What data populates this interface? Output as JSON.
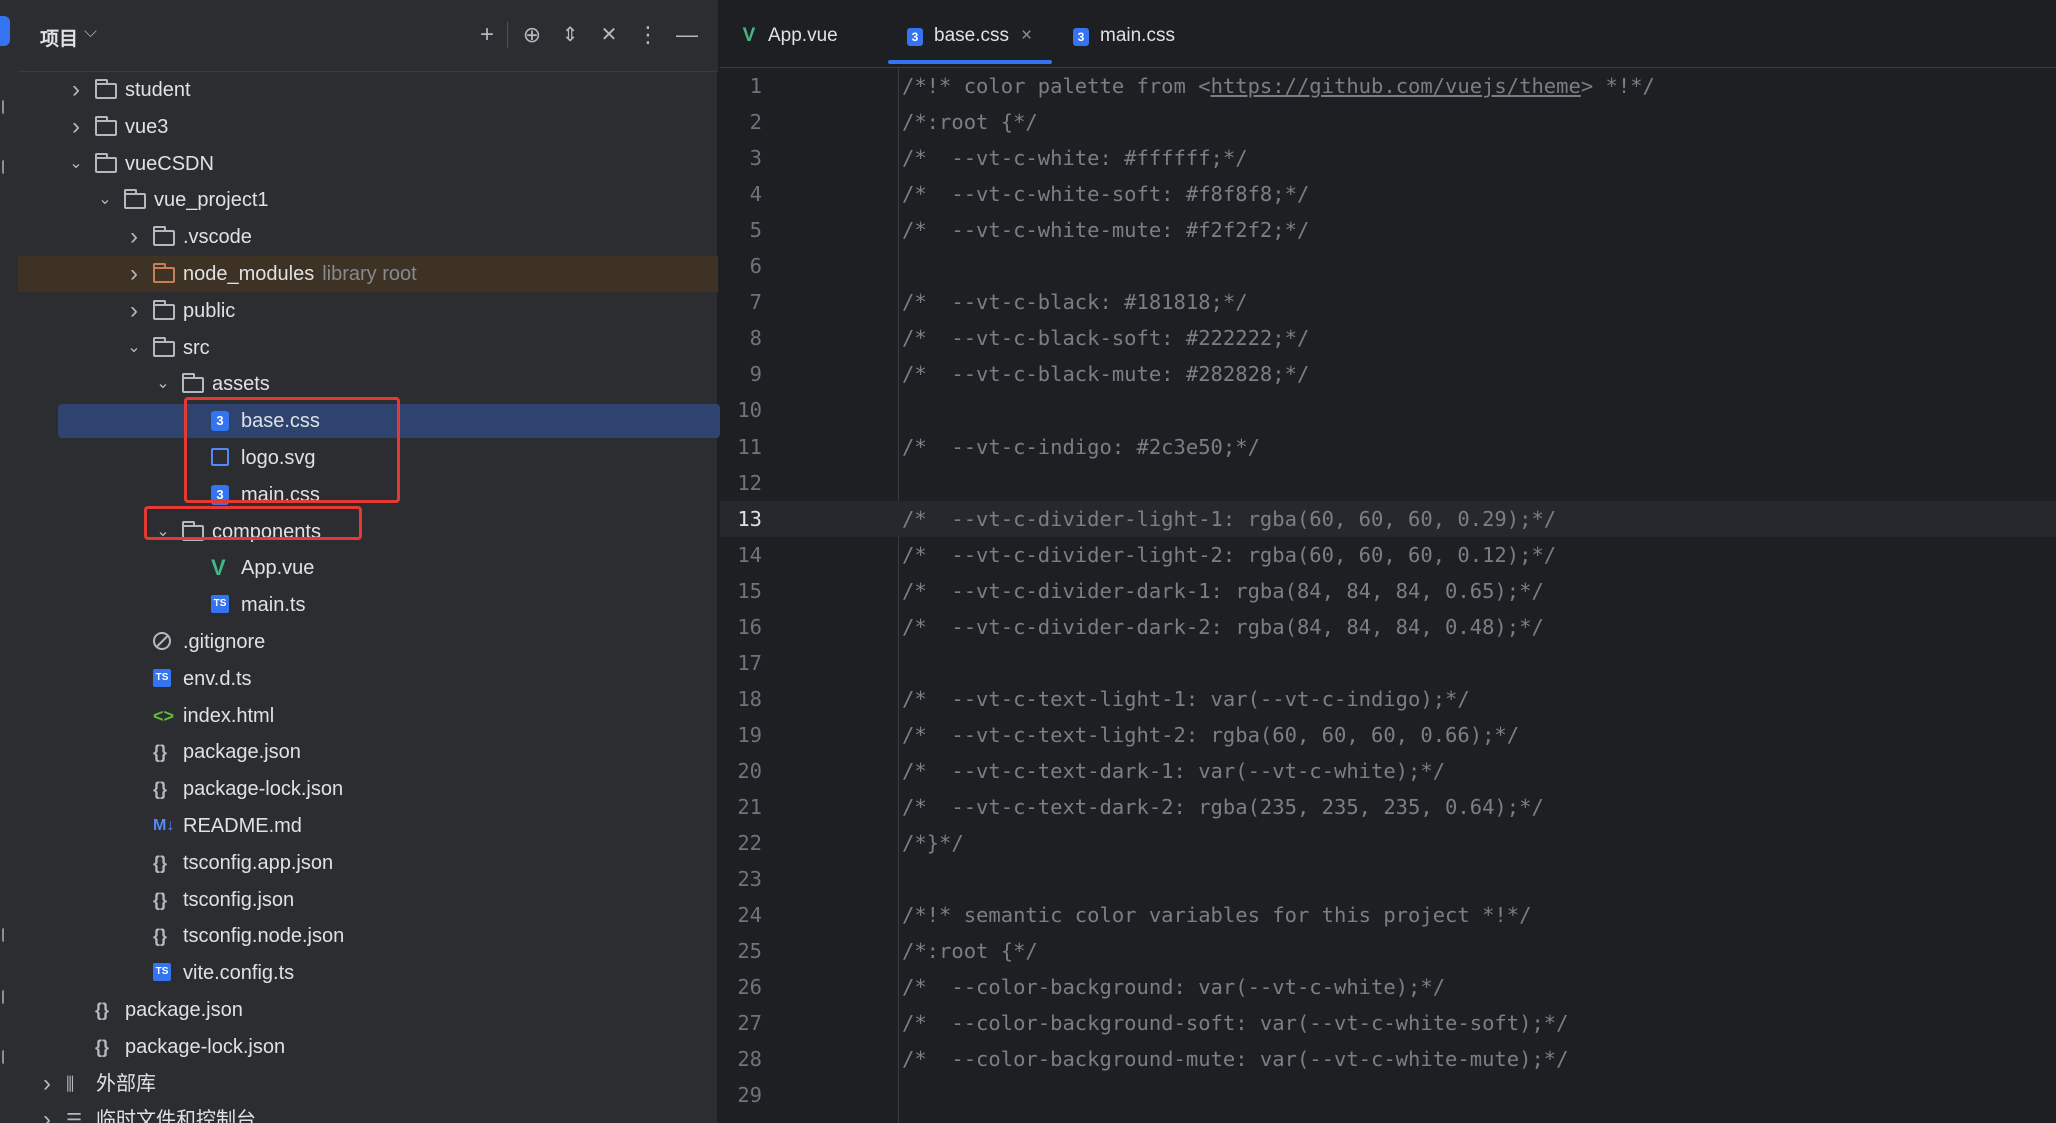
{
  "project_panel": {
    "title": "项目",
    "tools": [
      "add-icon",
      "locate-icon",
      "expand-all-icon",
      "collapse-all-icon",
      "more-icon",
      "minimize-icon"
    ],
    "tree": [
      {
        "label": "student",
        "icon": "folder-icon",
        "expanded": false
      },
      {
        "label": "vue3",
        "icon": "folder-icon",
        "expanded": false
      },
      {
        "label": "vueCSDN",
        "icon": "folder-icon",
        "expanded": true
      },
      {
        "label": "vue_project1",
        "icon": "folder-icon",
        "expanded": true
      },
      {
        "label": ".vscode",
        "icon": "folder-icon",
        "expanded": false
      },
      {
        "label": "node_modules",
        "hint": "library root",
        "icon": "folder-icon",
        "expanded": false
      },
      {
        "label": "public",
        "icon": "folder-icon",
        "expanded": false
      },
      {
        "label": "src",
        "icon": "folder-icon",
        "expanded": true
      },
      {
        "label": "assets",
        "icon": "folder-icon",
        "expanded": true
      },
      {
        "label": "base.css",
        "icon": "css-file-icon",
        "selected": true
      },
      {
        "label": "logo.svg",
        "icon": "image-file-icon"
      },
      {
        "label": "main.css",
        "icon": "css-file-icon"
      },
      {
        "label": "components",
        "icon": "folder-icon",
        "expanded": true
      },
      {
        "label": "App.vue",
        "icon": "vue-file-icon"
      },
      {
        "label": "main.ts",
        "icon": "ts-file-icon"
      },
      {
        "label": ".gitignore",
        "icon": "ignore-file-icon"
      },
      {
        "label": "env.d.ts",
        "icon": "ts-file-icon"
      },
      {
        "label": "index.html",
        "icon": "html-file-icon"
      },
      {
        "label": "package.json",
        "icon": "json-file-icon"
      },
      {
        "label": "package-lock.json",
        "icon": "json-file-icon"
      },
      {
        "label": "README.md",
        "icon": "markdown-file-icon"
      },
      {
        "label": "tsconfig.app.json",
        "icon": "json-file-icon"
      },
      {
        "label": "tsconfig.json",
        "icon": "json-file-icon"
      },
      {
        "label": "tsconfig.node.json",
        "icon": "json-file-icon"
      },
      {
        "label": "vite.config.ts",
        "icon": "ts-file-icon"
      },
      {
        "label": "package.json",
        "icon": "json-file-icon"
      },
      {
        "label": "package-lock.json",
        "icon": "json-file-icon"
      },
      {
        "label": "外部库",
        "icon": "external-libraries-icon",
        "expanded": false
      },
      {
        "label": "临时文件和控制台",
        "icon": "scratches-icon",
        "expanded": false
      }
    ]
  },
  "editor": {
    "tabs": [
      {
        "label": "App.vue",
        "icon": "vue-file-icon"
      },
      {
        "label": "base.css",
        "icon": "css-file-icon",
        "active": true,
        "close": "×"
      },
      {
        "label": "main.css",
        "icon": "css-file-icon"
      }
    ],
    "current_line": 13,
    "lines": [
      {
        "n": "1",
        "pre": "/*!* color palette from <",
        "link": "https://github.com/vuejs/theme",
        "post": "> *!*/"
      },
      {
        "n": "2",
        "pre": "/*:root {*/"
      },
      {
        "n": "3",
        "pre": "/*  --vt-c-white: #ffffff;*/"
      },
      {
        "n": "4",
        "pre": "/*  --vt-c-white-soft: #f8f8f8;*/"
      },
      {
        "n": "5",
        "pre": "/*  --vt-c-white-mute: #f2f2f2;*/"
      },
      {
        "n": "6",
        "pre": ""
      },
      {
        "n": "7",
        "pre": "/*  --vt-c-black: #181818;*/"
      },
      {
        "n": "8",
        "pre": "/*  --vt-c-black-soft: #222222;*/"
      },
      {
        "n": "9",
        "pre": "/*  --vt-c-black-mute: #282828;*/"
      },
      {
        "n": "10",
        "pre": ""
      },
      {
        "n": "11",
        "pre": "/*  --vt-c-indigo: #2c3e50;*/"
      },
      {
        "n": "12",
        "pre": ""
      },
      {
        "n": "13",
        "pre": "/*  --vt-c-divider-light-1: rgba(60, 60, 60, 0.29);*/"
      },
      {
        "n": "14",
        "pre": "/*  --vt-c-divider-light-2: rgba(60, 60, 60, 0.12);*/"
      },
      {
        "n": "15",
        "pre": "/*  --vt-c-divider-dark-1: rgba(84, 84, 84, 0.65);*/"
      },
      {
        "n": "16",
        "pre": "/*  --vt-c-divider-dark-2: rgba(84, 84, 84, 0.48);*/"
      },
      {
        "n": "17",
        "pre": ""
      },
      {
        "n": "18",
        "pre": "/*  --vt-c-text-light-1: var(--vt-c-indigo);*/"
      },
      {
        "n": "19",
        "pre": "/*  --vt-c-text-light-2: rgba(60, 60, 60, 0.66);*/"
      },
      {
        "n": "20",
        "pre": "/*  --vt-c-text-dark-1: var(--vt-c-white);*/"
      },
      {
        "n": "21",
        "pre": "/*  --vt-c-text-dark-2: rgba(235, 235, 235, 0.64);*/"
      },
      {
        "n": "22",
        "pre": "/*}*/"
      },
      {
        "n": "23",
        "pre": ""
      },
      {
        "n": "24",
        "pre": "/*!* semantic color variables for this project *!*/"
      },
      {
        "n": "25",
        "pre": "/*:root {*/"
      },
      {
        "n": "26",
        "pre": "/*  --color-background: var(--vt-c-white);*/"
      },
      {
        "n": "27",
        "pre": "/*  --color-background-soft: var(--vt-c-white-soft);*/"
      },
      {
        "n": "28",
        "pre": "/*  --color-background-mute: var(--vt-c-white-mute);*/"
      },
      {
        "n": "29",
        "pre": ""
      }
    ]
  },
  "colors": {
    "accent": "#3574f0",
    "selection": "#2e436e",
    "library_root_bg": "#3d3223",
    "annotation_red": "#e53935",
    "comment": "#7a7e85"
  }
}
